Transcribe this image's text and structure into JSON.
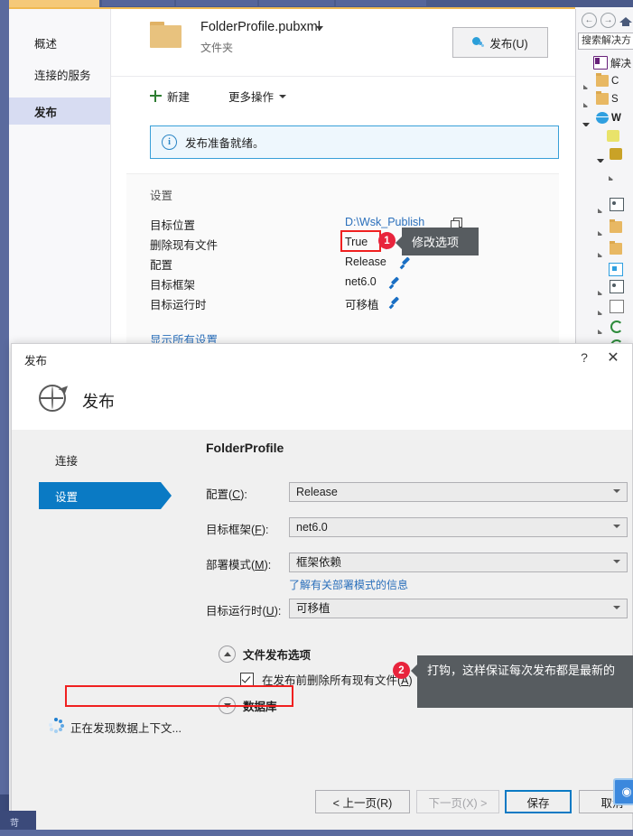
{
  "shell": {
    "left_nav": [
      {
        "label": "概述",
        "selected": false
      },
      {
        "label": "连接的服务",
        "selected": false
      },
      {
        "label": "发布",
        "selected": true
      }
    ],
    "profile": {
      "name": "FolderProfile.pubxml",
      "subtitle": "文件夹",
      "publish_button": "发布(U)"
    },
    "toolbar": {
      "new_label": "新建",
      "more_label": "更多操作"
    },
    "info_bar": {
      "text": "发布准备就绪。"
    },
    "settings": {
      "title": "设置",
      "rows": [
        {
          "key": "目标位置",
          "value": "D:\\Wsk_Publish",
          "kind": "link-copy"
        },
        {
          "key": "删除现有文件",
          "value": "True",
          "kind": "pencil"
        },
        {
          "key": "配置",
          "value": "Release",
          "kind": "pencil"
        },
        {
          "key": "目标框架",
          "value": "net6.0",
          "kind": "pencil"
        },
        {
          "key": "目标运行时",
          "value": "可移植",
          "kind": "pencil"
        }
      ],
      "show_all": "显示所有设置"
    },
    "callouts": [
      {
        "badge": "1",
        "text": "修改选项"
      },
      {
        "badge": "2",
        "text": "打钩，这样保证每次发布都是最新的"
      }
    ]
  },
  "solution_explorer": {
    "search_placeholder": "搜索解决方",
    "rows": [
      {
        "indent": 0,
        "tri": "none",
        "icon": "solution-icon",
        "label": "解决"
      },
      {
        "indent": 0,
        "tri": "closed",
        "icon": "folder-icon",
        "label": "C"
      },
      {
        "indent": 0,
        "tri": "closed",
        "icon": "folder-icon",
        "label": "S"
      },
      {
        "indent": 0,
        "tri": "open",
        "icon": "web-project-icon",
        "label": "W"
      },
      {
        "indent": 1,
        "tri": "none",
        "icon": "connected-service-icon",
        "label": ""
      },
      {
        "indent": 1,
        "tri": "open",
        "icon": "key-icon",
        "label": ""
      },
      {
        "indent": 2,
        "tri": "closed",
        "icon": "folder-icon",
        "label": ""
      },
      {
        "indent": 1,
        "tri": "closed",
        "icon": "dependencies-icon",
        "label": ""
      },
      {
        "indent": 1,
        "tri": "closed",
        "icon": "folder-icon",
        "label": ""
      },
      {
        "indent": 1,
        "tri": "closed",
        "icon": "folder-icon",
        "label": ""
      },
      {
        "indent": 1,
        "tri": "none",
        "icon": "properties-icon",
        "label": ""
      },
      {
        "indent": 1,
        "tri": "closed",
        "icon": "dependencies-icon",
        "label": ""
      },
      {
        "indent": 1,
        "tri": "closed",
        "icon": "file-icon",
        "label": ""
      },
      {
        "indent": 1,
        "tri": "closed",
        "icon": "csharp-icon",
        "label": ""
      },
      {
        "indent": 1,
        "tri": "closed",
        "icon": "csharp-icon",
        "label": ""
      },
      {
        "indent": 1,
        "tri": "none",
        "icon": "file-icon",
        "label": ""
      }
    ]
  },
  "dialog": {
    "window_title": "发布",
    "help_glyph": "?",
    "close_glyph": "✕",
    "header_title": "发布",
    "sidenav": [
      {
        "label": "连接",
        "selected": false
      },
      {
        "label": "设置",
        "selected": true
      }
    ],
    "form_title": "FolderProfile",
    "fields": [
      {
        "label": "配置(",
        "accel": "C",
        "label_tail": "):",
        "value": "Release"
      },
      {
        "label": "目标框架(",
        "accel": "F",
        "label_tail": "):",
        "value": "net6.0"
      },
      {
        "label": "部署模式(",
        "accel": "M",
        "label_tail": "):",
        "value": "框架依赖"
      },
      {
        "label": "目标运行时(",
        "accel": "U",
        "label_tail": "):",
        "value": "可移植"
      }
    ],
    "deploy_link": "了解有关部署模式的信息",
    "group_file_options": "文件发布选项",
    "checkbox_label_head": "在发布前删除所有现有文件(",
    "checkbox_accel": "A",
    "checkbox_label_tail": ")",
    "checkbox_checked": true,
    "group_database": "数据库",
    "discovering_text": "正在发现数据上下文...",
    "buttons": {
      "prev": "< 上一页(R)",
      "next": "下一页(X) >",
      "save": "保存",
      "cancel": "取消"
    }
  },
  "taskbar": {
    "label": "苛"
  },
  "colors": {
    "accent_blue": "#0a7ac4",
    "link_blue": "#2a6fbb",
    "badge_red": "#e8243c",
    "highlight_red": "#f02020",
    "callout_gray": "#575c60",
    "shell_navy": "#5a6a9e",
    "tab_orange": "#f5c978"
  }
}
